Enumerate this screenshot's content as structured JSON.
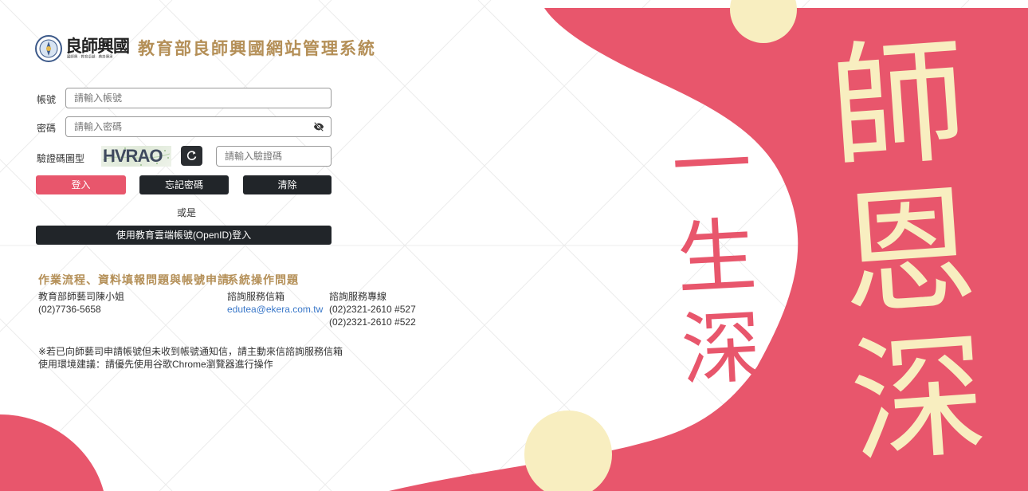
{
  "header": {
    "logo_text": "良師興國",
    "logo_subtitle": "國師興 · 教育卓越 · 典泉傳承",
    "title": "教育部良師興國網站管理系統"
  },
  "form": {
    "account_label": "帳號",
    "account_placeholder": "請輸入帳號",
    "password_label": "密碼",
    "password_placeholder": "請輸入密碼",
    "captcha_label": "驗證碼圖型",
    "captcha_text": "HVRAO",
    "captcha_placeholder": "請輸入驗證碼",
    "login_label": "登入",
    "forgot_label": "忘記密碼",
    "clear_label": "清除",
    "or_text": "或是",
    "openid_label": "使用教育雲端帳號(OpenID)登入"
  },
  "contact": {
    "workflow_heading": "作業流程、資料填報問題與帳號申請",
    "workflow_name": "教育部師藝司陳小姐",
    "workflow_phone": "(02)7736-5658",
    "system_heading": "系統操作問題",
    "email_label": "諮詢服務信箱",
    "email": "edutea@ekera.com.tw",
    "hotline_label": "諮詢服務專線",
    "hotline_1": "(02)2321-2610 #527",
    "hotline_2": "(02)2321-2610 #522"
  },
  "notes": {
    "line1": "※若已向師藝司申請帳號但未收到帳號通知信，請主動來信諮詢服務信箱",
    "line2": "使用環境建議：請優先使用谷歌Chrome瀏覽器進行操作"
  },
  "decoration": {
    "calligraphy_main": "師恩深",
    "calligraphy_sub": "一生深"
  },
  "colors": {
    "accent_pink": "#e8566c",
    "gold": "#b48f57",
    "cream": "#f8eec0",
    "dark_button": "#212529",
    "link_blue": "#3a78c9"
  },
  "icons": {
    "password_toggle": "eye-slash-icon",
    "captcha_refresh": "refresh-icon"
  }
}
